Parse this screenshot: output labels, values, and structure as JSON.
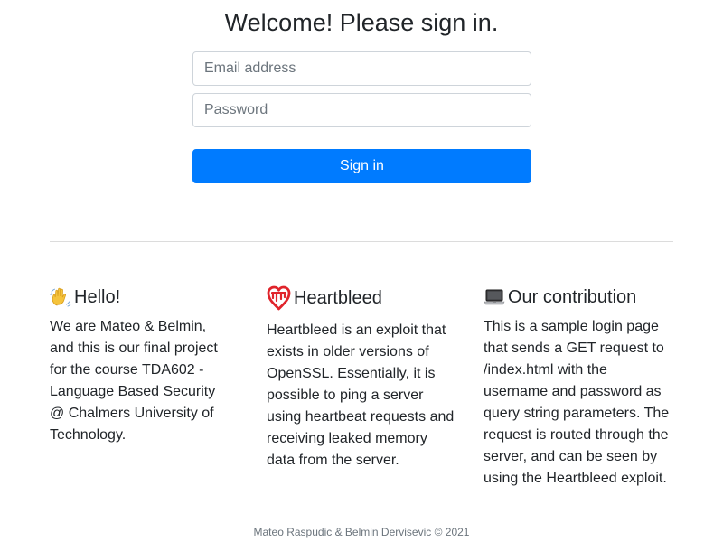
{
  "form": {
    "title": "Welcome! Please sign in.",
    "email_placeholder": "Email address",
    "password_placeholder": "Password",
    "submit_label": "Sign in",
    "accent_color": "#007bff"
  },
  "sections": [
    {
      "icon": "waving-hand-icon",
      "heading": "Hello!",
      "text": "We are Mateo & Belmin, and this is our final project for the course TDA602 - Language Based Security @ Chalmers University of Technology."
    },
    {
      "icon": "heartbleed-icon",
      "heading": "Heartbleed",
      "text": "Heartbleed is an exploit that exists in older versions of OpenSSL. Essentially, it is possible to ping a server using heartbeat requests and receiving leaked memory data from the server."
    },
    {
      "icon": "laptop-icon",
      "heading": "Our contribution",
      "text": "This is a sample login page that sends a GET request to /index.html with the username and password as query string parameters. The request is routed through the server, and can be seen by using the Heartbleed exploit."
    }
  ],
  "footer": {
    "text": "Mateo Raspudic & Belmin Dervisevic © 2021"
  }
}
